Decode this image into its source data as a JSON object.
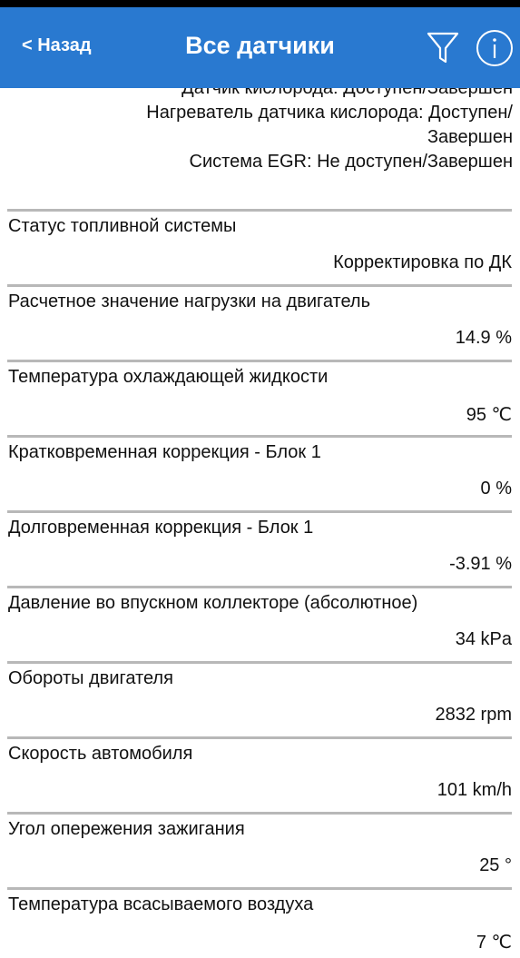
{
  "header": {
    "back_label": "< Назад",
    "title": "Все датчики",
    "filter_icon": "filter-funnel-icon",
    "info_icon": "info-circle-icon",
    "bar_color": "#2979d0"
  },
  "monitors": [
    "Датчик кислорода: Доступен/Завершен",
    "Нагреватель датчика кислорода: Доступен/",
    "Завершен",
    "Система EGR: Не доступен/Завершен"
  ],
  "sensors": [
    {
      "name": "Статус топливной системы",
      "value": "Корректировка по ДК"
    },
    {
      "name": "Расчетное значение нагрузки на двигатель",
      "value": "14.9 %"
    },
    {
      "name": "Температура охлаждающей жидкости",
      "value": "95 ℃"
    },
    {
      "name": "Кратковременная коррекция - Блок 1",
      "value": "0 %"
    },
    {
      "name": "Долговременная коррекция - Блок 1",
      "value": "-3.91 %"
    },
    {
      "name": "Давление во впускном коллекторе (абсолютное)",
      "value": "34 kPa"
    },
    {
      "name": "Обороты двигателя",
      "value": "2832 rpm"
    },
    {
      "name": "Скорость автомобиля",
      "value": "101 km/h"
    },
    {
      "name": "Угол опережения зажигания",
      "value": "25 °"
    },
    {
      "name": "Температура всасываемого воздуха",
      "value": "7 ℃"
    }
  ]
}
